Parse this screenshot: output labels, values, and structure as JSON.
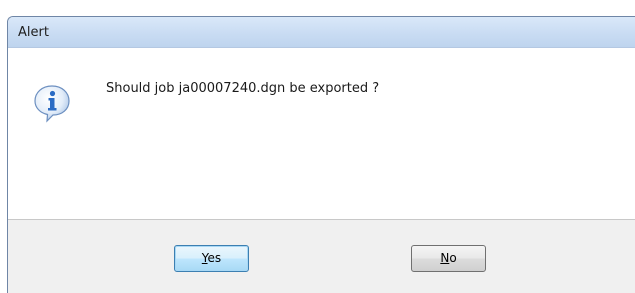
{
  "window": {
    "title": "Alert"
  },
  "dialog": {
    "icon": "info-icon",
    "message": "Should job ja00007240.dgn be exported ?"
  },
  "buttons": {
    "yes": {
      "mnemonic": "Y",
      "rest": "es"
    },
    "no": {
      "mnemonic": "N",
      "rest": "o"
    }
  },
  "colors": {
    "titlebar": "#c9dcf3",
    "icon_blue": "#2a6bc4",
    "default_button_border": "#3c7fb1"
  }
}
